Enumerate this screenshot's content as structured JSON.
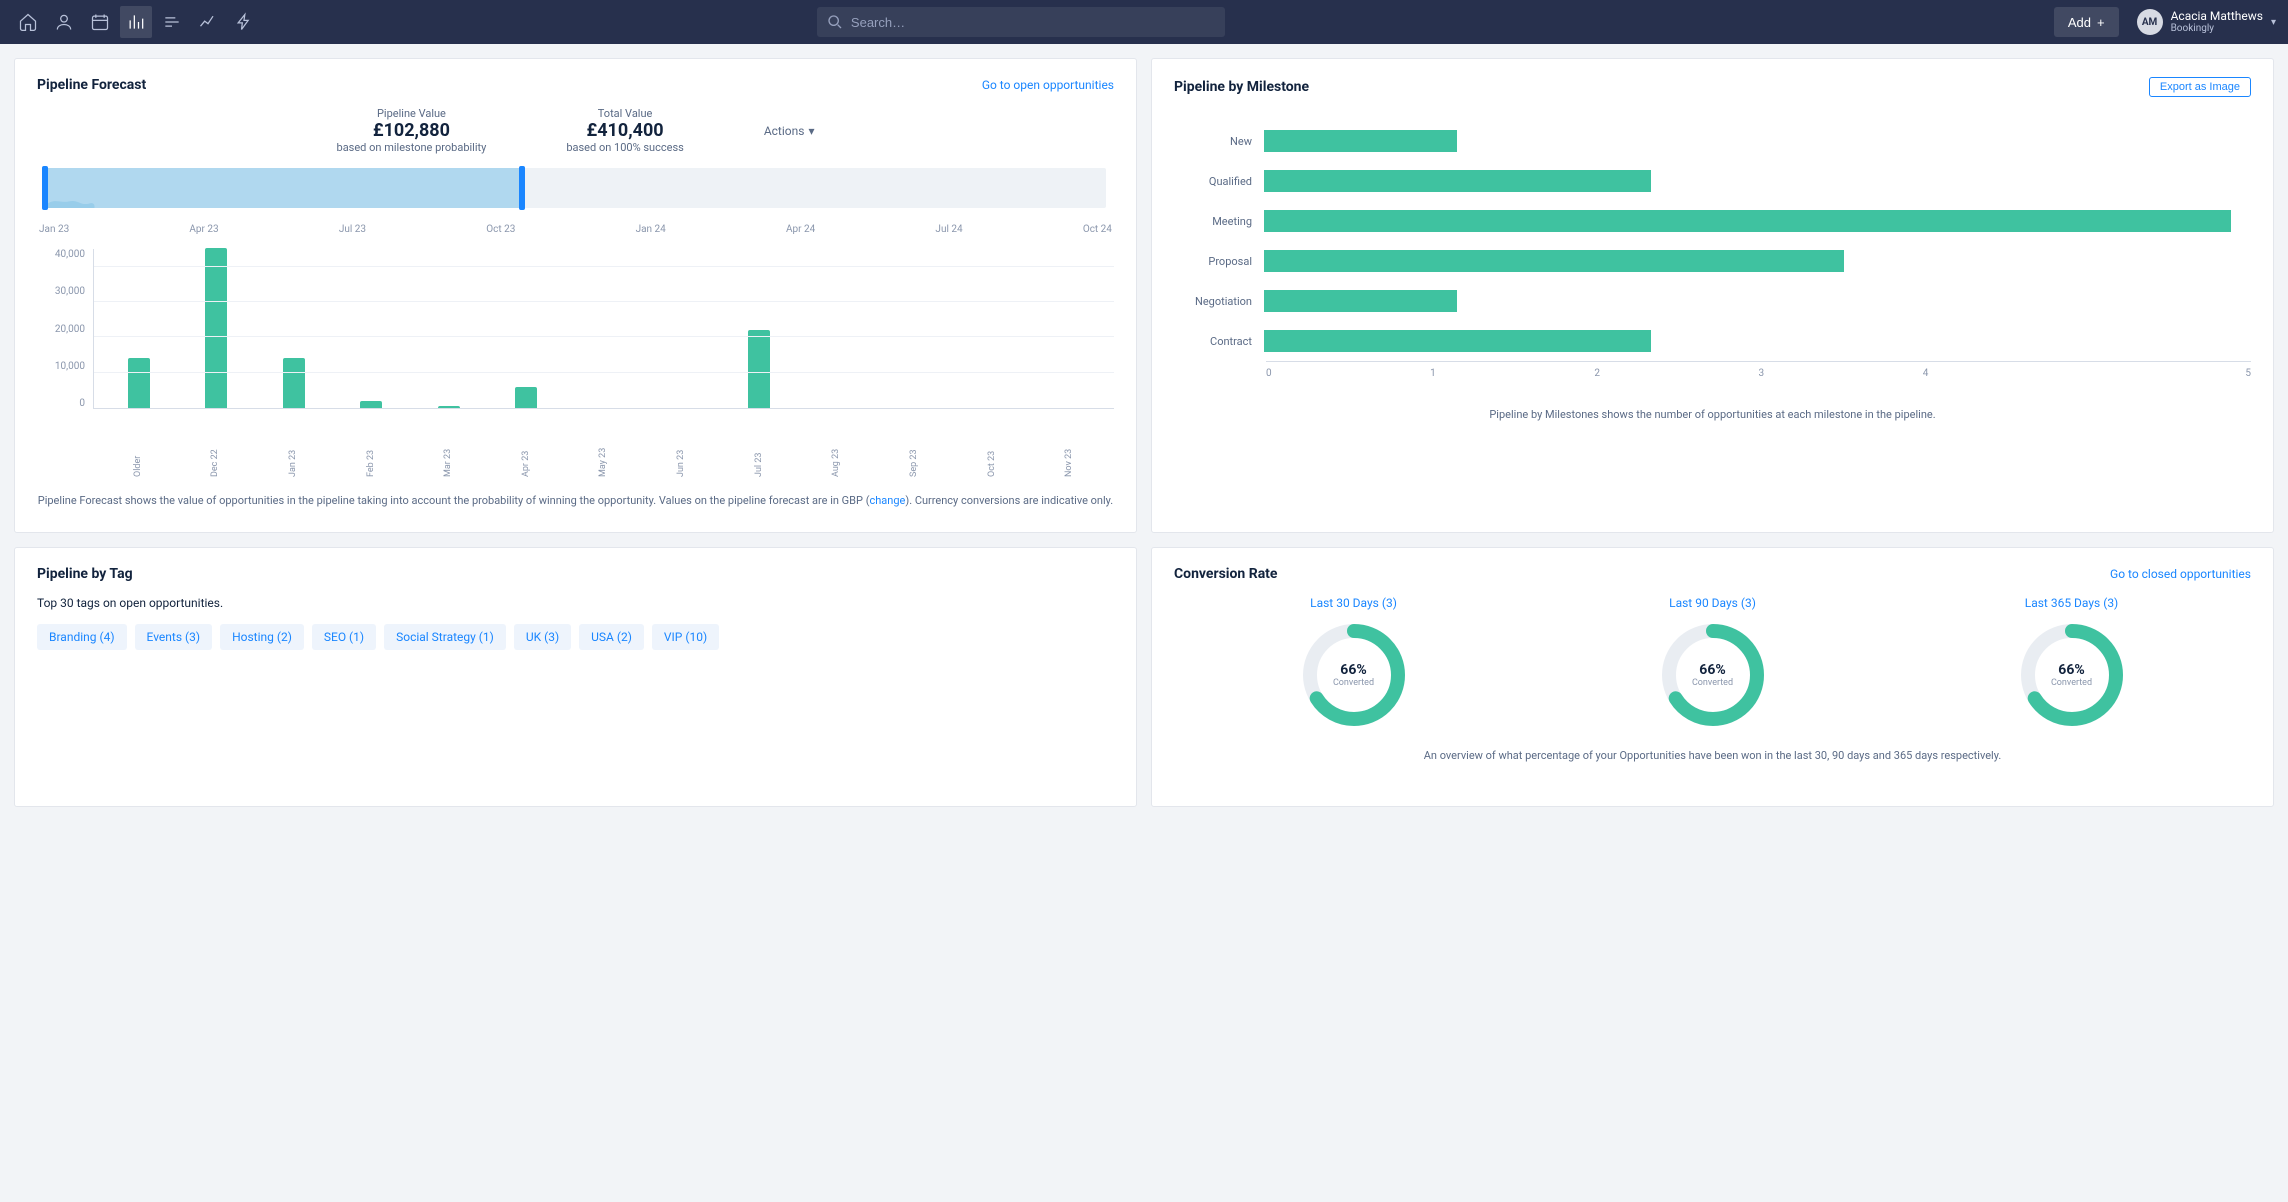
{
  "nav": {
    "search_placeholder": "Search…",
    "add_label": "Add",
    "user_name": "Acacia Matthews",
    "user_org": "Bookingly",
    "avatar_initials": "AM"
  },
  "forecast": {
    "title": "Pipeline Forecast",
    "header_link": "Go to open opportunities",
    "pipeline_value_label": "Pipeline Value",
    "pipeline_value": "£102,880",
    "pipeline_sub": "based on milestone probability",
    "total_value_label": "Total Value",
    "total_value": "£410,400",
    "total_sub": "based on 100% success",
    "actions_label": "Actions",
    "range_axis": [
      "Jan 23",
      "Apr 23",
      "Jul 23",
      "Oct 23",
      "Jan 24",
      "Apr 24",
      "Jul 24",
      "Oct 24"
    ],
    "range_selection": {
      "start_pct": 0,
      "end_pct": 45
    },
    "explain_pre": "Pipeline Forecast shows the value of opportunities in the pipeline taking into account the probability of winning the opportunity. Values on the pipeline forecast are in GBP (",
    "explain_link": "change",
    "explain_post": "). Currency conversions are indicative only."
  },
  "chart_data": {
    "forecast_bars": {
      "type": "bar",
      "title": "Pipeline Forecast",
      "ylabel": "",
      "ylim": [
        0,
        45000
      ],
      "yticks": [
        0,
        10000,
        20000,
        30000,
        40000
      ],
      "ytick_labels": [
        "0",
        "10,000",
        "20,000",
        "30,000",
        "40,000"
      ],
      "categories": [
        "Older",
        "Dec 22",
        "Jan 23",
        "Feb 23",
        "Mar 23",
        "Apr 23",
        "May 23",
        "Jun 23",
        "Jul 23",
        "Aug 23",
        "Sep 23",
        "Oct 23",
        "Nov 23"
      ],
      "values": [
        14000,
        45000,
        14000,
        2000,
        500,
        6000,
        0,
        0,
        22000,
        0,
        0,
        0,
        0
      ]
    },
    "milestones": {
      "type": "bar",
      "orientation": "horizontal",
      "title": "Pipeline by Milestone",
      "xlim": [
        0,
        5
      ],
      "xticks": [
        0,
        1,
        2,
        3,
        4,
        5
      ],
      "categories": [
        "New",
        "Qualified",
        "Meeting",
        "Proposal",
        "Negotiation",
        "Contract"
      ],
      "values": [
        1,
        2,
        5,
        3,
        1,
        2
      ]
    },
    "conversion": {
      "type": "donut",
      "series": [
        {
          "name": "Last 30 Days (3)",
          "value": 66
        },
        {
          "name": "Last 90 Days (3)",
          "value": 66
        },
        {
          "name": "Last 365 Days (3)",
          "value": 66
        }
      ],
      "value_label": "Converted"
    }
  },
  "milestone": {
    "title": "Pipeline by Milestone",
    "export_label": "Export as Image",
    "explain": "Pipeline by Milestones shows the number of opportunities at each milestone in the pipeline."
  },
  "tags_card": {
    "title": "Pipeline by Tag",
    "intro": "Top 30 tags on open opportunities.",
    "tags": [
      "Branding (4)",
      "Events (3)",
      "Hosting (2)",
      "SEO (1)",
      "Social Strategy (1)",
      "UK (3)",
      "USA (2)",
      "VIP (10)"
    ]
  },
  "conversion_card": {
    "title": "Conversion Rate",
    "header_link": "Go to closed opportunities",
    "pct_suffix": "%",
    "explain": "An overview of what percentage of your Opportunities have been won in the last 30, 90 days and 365 days respectively."
  },
  "colors": {
    "navy": "#27304d",
    "accent_green": "#3fc2a0",
    "accent_blue": "#1a86ff",
    "range_fill": "#b0d8ef"
  }
}
